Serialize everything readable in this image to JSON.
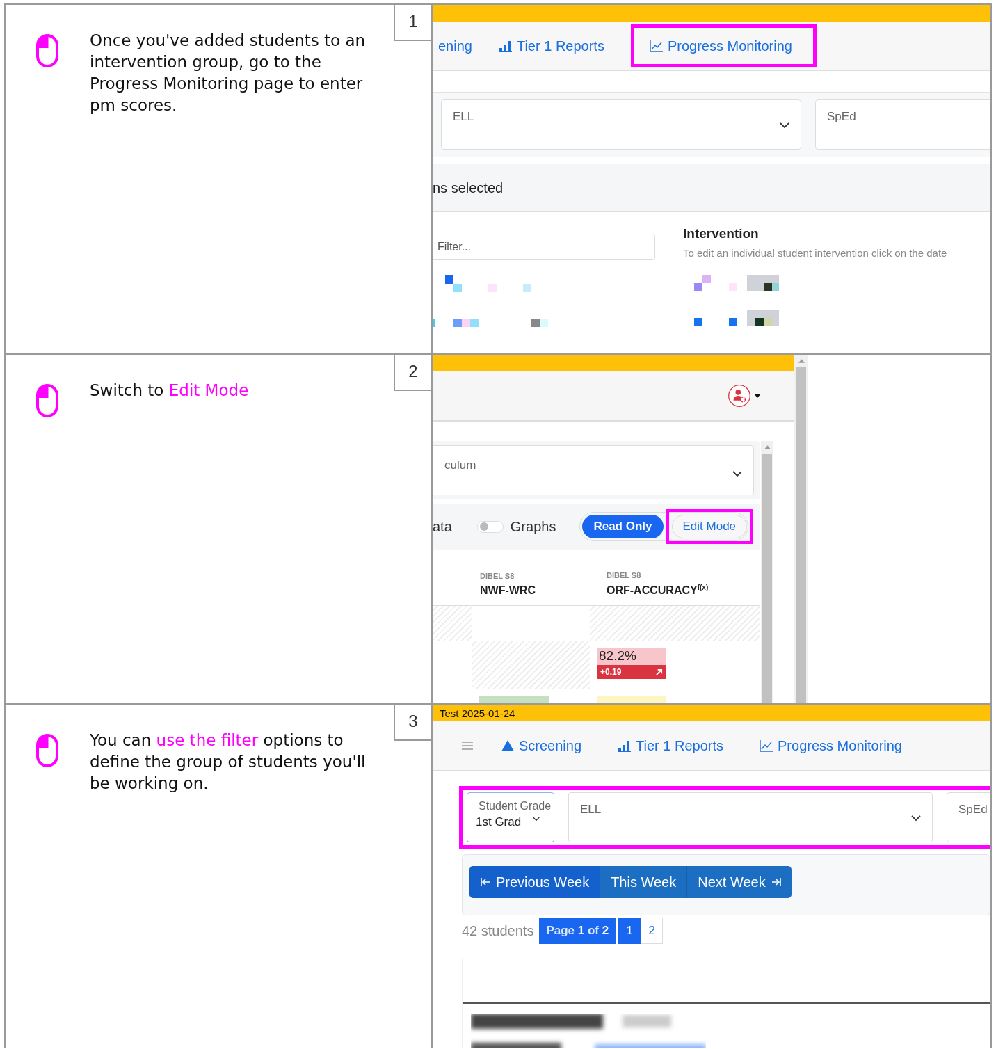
{
  "steps": [
    {
      "number": "1",
      "parts": [
        {
          "kind": "plain",
          "text": "Once you've added students to an intervention group, go to the Progress Monitoring page to enter pm scores."
        }
      ],
      "screen": {
        "kind": "nav-page",
        "tabs": [
          {
            "label": "ening",
            "kind": "screening",
            "highlighted": false
          },
          {
            "label": "Tier 1 Reports",
            "kind": "reports",
            "highlighted": false
          },
          {
            "label": "Progress Monitoring",
            "kind": "monitoring",
            "highlighted": true
          }
        ],
        "selects": [
          {
            "label": "ELL",
            "caret": true
          },
          {
            "label": "SpEd",
            "caret": false
          }
        ],
        "selection_text": "ns selected",
        "filter_placeholder": "Filter...",
        "intervention_title": "Intervention",
        "intervention_hint": "To edit an individual student intervention click on the date"
      }
    },
    {
      "number": "2",
      "parts": [
        {
          "kind": "plain",
          "text": "Switch to "
        },
        {
          "kind": "highlight",
          "text": "Edit Mode"
        }
      ],
      "screen": {
        "kind": "mode-page",
        "select_label": "culum",
        "view_label": "ata",
        "graphs_toggle": {
          "label": "Graphs",
          "on": false
        },
        "modes": [
          {
            "label": "Read Only",
            "selected": true,
            "highlighted": false
          },
          {
            "label": "Edit Mode",
            "selected": false,
            "highlighted": true
          }
        ],
        "columns": [
          {
            "group": "DIBEL S8",
            "name": "NWF-WRC"
          },
          {
            "group": "DIBEL S8",
            "name": "ORF-ACCURACY",
            "formula": "f(x)"
          }
        ],
        "score": {
          "value": "82.2%",
          "change": "+0.19"
        }
      }
    },
    {
      "number": "3",
      "parts": [
        {
          "kind": "plain",
          "text": "You can "
        },
        {
          "kind": "highlight",
          "text": "use the filter"
        },
        {
          "kind": "plain",
          "text": " options to define the group of students you'll be working on."
        }
      ],
      "screen": {
        "kind": "filter-page",
        "banner": "Test 2025-01-24",
        "tabs": [
          {
            "label": "Screening",
            "kind": "screening",
            "highlighted": false
          },
          {
            "label": "Tier 1 Reports",
            "kind": "reports",
            "highlighted": false
          },
          {
            "label": "Progress Monitoring",
            "kind": "monitoring",
            "highlighted": false
          }
        ],
        "grade": {
          "label": "Student Grade",
          "value": "1st Grad"
        },
        "selects": [
          {
            "label": "ELL"
          },
          {
            "label": "SpEd"
          }
        ],
        "filters_highlighted": true,
        "weeks": [
          {
            "label": "Previous Week",
            "kind": "previous"
          },
          {
            "label": "This Week",
            "kind": "current"
          },
          {
            "label": "Next Week",
            "kind": "next"
          }
        ],
        "count": "42 students",
        "page_info": "Page **1** of **2**",
        "pages": [
          {
            "label": "1",
            "selected": true
          },
          {
            "label": "2",
            "selected": false
          }
        ]
      }
    }
  ]
}
